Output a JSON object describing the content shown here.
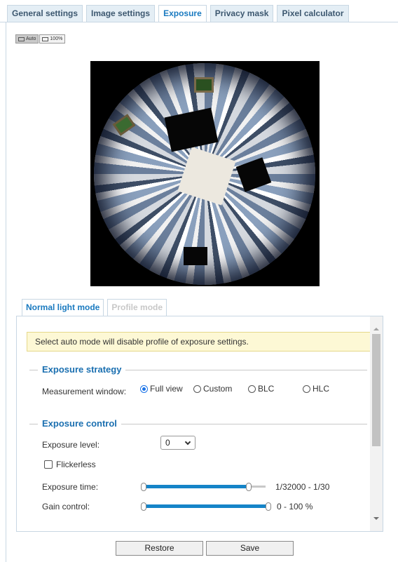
{
  "tabs": [
    {
      "label": "General settings",
      "active": false
    },
    {
      "label": "Image settings",
      "active": false
    },
    {
      "label": "Exposure",
      "active": true
    },
    {
      "label": "Privacy mask",
      "active": false
    },
    {
      "label": "Pixel calculator",
      "active": false
    }
  ],
  "view_buttons": {
    "auto": "Auto",
    "full": "100%"
  },
  "subtabs": [
    {
      "label": "Normal light mode",
      "active": true
    },
    {
      "label": "Profile mode",
      "active": false
    }
  ],
  "notice": "Select auto mode will disable profile of exposure settings.",
  "exposure_strategy": {
    "title": "Exposure strategy",
    "measurement_label": "Measurement window:",
    "options": [
      {
        "label": "Full view",
        "checked": true
      },
      {
        "label": "Custom",
        "checked": false
      },
      {
        "label": "BLC",
        "checked": false
      },
      {
        "label": "HLC",
        "checked": false
      }
    ]
  },
  "exposure_control": {
    "title": "Exposure control",
    "level_label": "Exposure level:",
    "level_value": "0",
    "flickerless_label": "Flickerless",
    "flickerless_checked": false,
    "time_label": "Exposure time:",
    "time_range": "1/32000 - 1/30",
    "time_slider": {
      "low": 0.0,
      "high": 0.88
    },
    "gain_label": "Gain control:",
    "gain_range": "0 - 100 %",
    "gain_slider": {
      "low": 0.0,
      "high": 1.0
    }
  },
  "buttons": {
    "restore": "Restore",
    "save": "Save"
  },
  "colors": {
    "accent": "#1a7ac0",
    "slider": "#1584c8",
    "notice_bg": "#fdf8d5"
  }
}
